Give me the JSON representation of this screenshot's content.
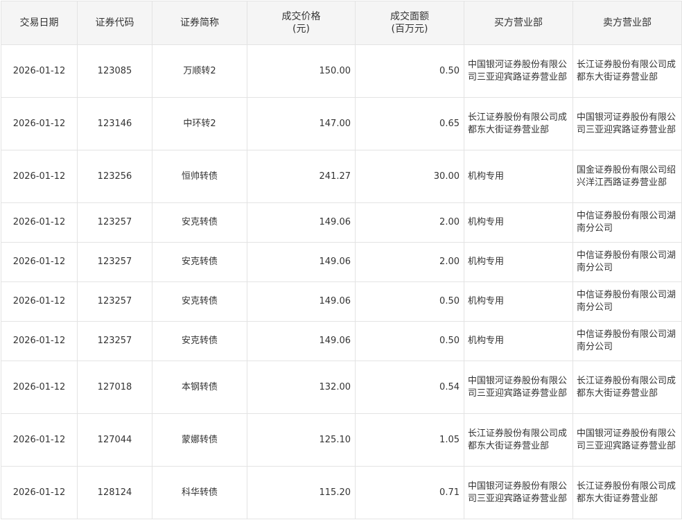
{
  "table": {
    "headers": [
      {
        "key": "date",
        "label": "交易日期"
      },
      {
        "key": "code",
        "label": "证券代码"
      },
      {
        "key": "name",
        "label": "证券简称"
      },
      {
        "key": "price",
        "label": "成交价格\n(元)"
      },
      {
        "key": "amount",
        "label": "成交面额\n(百万元)"
      },
      {
        "key": "buyer",
        "label": "买方营业部"
      },
      {
        "key": "seller",
        "label": "卖方营业部"
      }
    ],
    "rows": [
      {
        "date": "2026-01-12",
        "code": "123085",
        "name": "万顺转2",
        "price": "150.00",
        "amount": "0.50",
        "buyer": "中国银河证券股份有限公司三亚迎宾路证券营业部",
        "seller": "长江证券股份有限公司成都东大街证券营业部"
      },
      {
        "date": "2026-01-12",
        "code": "123146",
        "name": "中环转2",
        "price": "147.00",
        "amount": "0.65",
        "buyer": "长江证券股份有限公司成都东大街证券营业部",
        "seller": "中国银河证券股份有限公司三亚迎宾路证券营业部"
      },
      {
        "date": "2026-01-12",
        "code": "123256",
        "name": "恒帅转债",
        "price": "241.27",
        "amount": "30.00",
        "buyer": "机构专用",
        "seller": "国金证券股份有限公司绍兴洋江西路证券营业部"
      },
      {
        "date": "2026-01-12",
        "code": "123257",
        "name": "安克转债",
        "price": "149.06",
        "amount": "2.00",
        "buyer": "机构专用",
        "seller": "中信证券股份有限公司湖南分公司"
      },
      {
        "date": "2026-01-12",
        "code": "123257",
        "name": "安克转债",
        "price": "149.06",
        "amount": "2.00",
        "buyer": "机构专用",
        "seller": "中信证券股份有限公司湖南分公司"
      },
      {
        "date": "2026-01-12",
        "code": "123257",
        "name": "安克转债",
        "price": "149.06",
        "amount": "0.50",
        "buyer": "机构专用",
        "seller": "中信证券股份有限公司湖南分公司"
      },
      {
        "date": "2026-01-12",
        "code": "123257",
        "name": "安克转债",
        "price": "149.06",
        "amount": "0.50",
        "buyer": "机构专用",
        "seller": "中信证券股份有限公司湖南分公司"
      },
      {
        "date": "2026-01-12",
        "code": "127018",
        "name": "本钢转债",
        "price": "132.00",
        "amount": "0.54",
        "buyer": "中国银河证券股份有限公司三亚迎宾路证券营业部",
        "seller": "长江证券股份有限公司成都东大街证券营业部"
      },
      {
        "date": "2026-01-12",
        "code": "127044",
        "name": "蒙娜转债",
        "price": "125.10",
        "amount": "1.05",
        "buyer": "长江证券股份有限公司成都东大街证券营业部",
        "seller": "中国银河证券股份有限公司三亚迎宾路证券营业部"
      },
      {
        "date": "2026-01-12",
        "code": "128124",
        "name": "科华转债",
        "price": "115.20",
        "amount": "0.71",
        "buyer": "中国银河证券股份有限公司三亚迎宾路证券营业部",
        "seller": "长江证券股份有限公司成都东大街证券营业部"
      }
    ]
  }
}
